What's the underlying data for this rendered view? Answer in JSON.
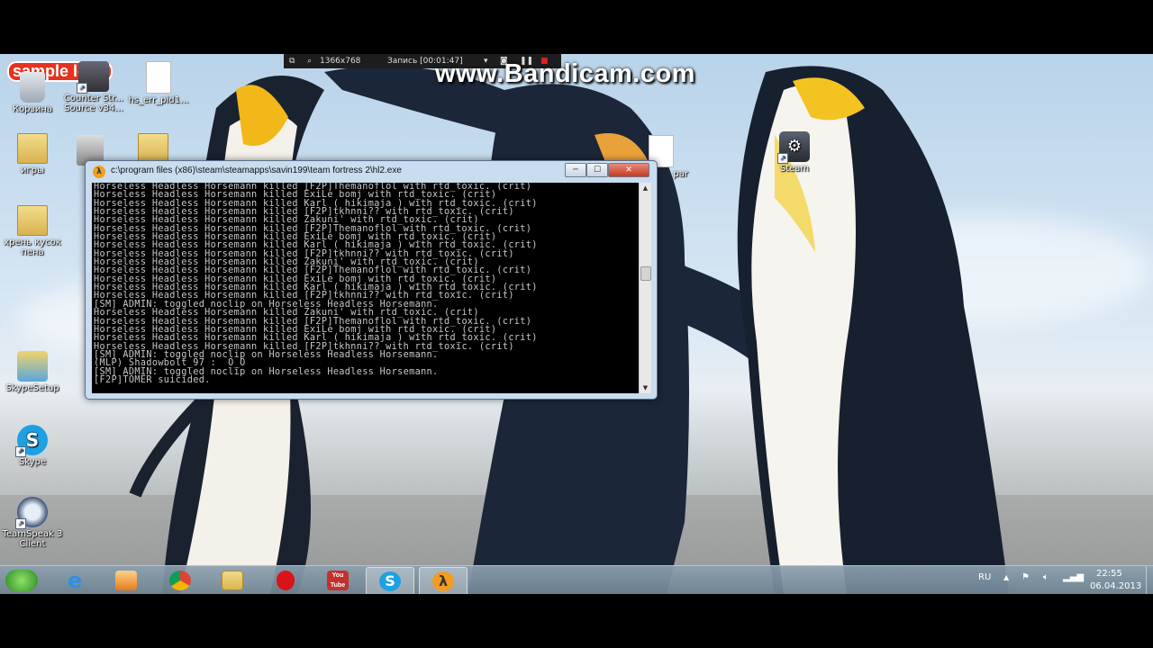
{
  "recording_bar": {
    "resolution": "1366x768",
    "status": "Запись [00:01:47]"
  },
  "watermark": "www.Bandicam.com",
  "sample_logo": "sample logo",
  "desktop_icons": [
    {
      "id": "recycle",
      "label": "Корзина"
    },
    {
      "id": "cs",
      "label": "Counter Str... Source v34..."
    },
    {
      "id": "hs_err",
      "label": "hs_err_pid1..."
    },
    {
      "id": "igry",
      "label": "игры"
    },
    {
      "id": "hren",
      "label": "хрень кусок пена"
    },
    {
      "id": "skypesetup",
      "label": "SkypeSetup"
    },
    {
      "id": "skype",
      "label": "Skype"
    },
    {
      "id": "ts3",
      "label": "TeamSpeak 3 Client"
    },
    {
      "id": "steam",
      "label": "Steam"
    },
    {
      "id": "par",
      "label": "par"
    }
  ],
  "console_window": {
    "title": "c:\\program files (x86)\\steam\\steamapps\\savin199\\team fortress 2\\hl2.exe",
    "lines": [
      "Horseless Headless Horsemann killed [F2P]Themanoflol with rtd_toxic. (crit)",
      "Horseless Headless Horsemann killed ExiLe bomj with rtd_toxic. (crit)",
      "Horseless Headless Horsemann killed Karl ( hikimaja ) with rtd_toxic. (crit)",
      "Horseless Headless Horsemann killed [F2P]tkhnni?? with rtd_toxic. (crit)",
      "Horseless Headless Horsemann killed Zakuni' with rtd_toxic. (crit)",
      "Horseless Headless Horsemann killed [F2P]Themanoflol with rtd_toxic. (crit)",
      "Horseless Headless Horsemann killed ExiLe bomj with rtd_toxic. (crit)",
      "Horseless Headless Horsemann killed Karl ( hikimaja ) with rtd_toxic. (crit)",
      "Horseless Headless Horsemann killed [F2P]tkhnni?? with rtd_toxic. (crit)",
      "Horseless Headless Horsemann killed Zakuni' with rtd_toxic. (crit)",
      "Horseless Headless Horsemann killed [F2P]Themanoflol with rtd_toxic. (crit)",
      "Horseless Headless Horsemann killed ExiLe bomj with rtd_toxic. (crit)",
      "Horseless Headless Horsemann killed Karl ( hikimaja ) with rtd_toxic. (crit)",
      "Horseless Headless Horsemann killed [F2P]tkhnni?? with rtd_toxic. (crit)",
      "[SM] ADMIN: toggled noclip on Horseless Headless Horsemann.",
      "Horseless Headless Horsemann killed Zakuni' with rtd_toxic. (crit)",
      "Horseless Headless Horsemann killed [F2P]Themanoflol with rtd_toxic. (crit)",
      "Horseless Headless Horsemann killed ExiLe bomj with rtd_toxic. (crit)",
      "Horseless Headless Horsemann killed Karl ( hikimaja ) with rtd_toxic. (crit)",
      "Horseless Headless Horsemann killed [F2P]tkhnni?? with rtd_toxic. (crit)",
      "[SM] ADMIN: toggled noclip on Horseless Headless Horsemann.",
      "(MLP) Shadowbolt_97 :  O_O",
      "[SM] ADMIN: toggled noclip on Horseless Headless Horsemann.",
      "[F2P]TOMER suicided."
    ],
    "scroll_position": 0.42
  },
  "taskbar": {
    "language": "RU",
    "time": "22:55",
    "date": "06.04.2013",
    "apps": [
      {
        "id": "start",
        "icon": "start-orb-icon"
      },
      {
        "id": "ie",
        "icon": "internet-explorer-icon"
      },
      {
        "id": "media",
        "icon": "media-player-icon"
      },
      {
        "id": "chrome",
        "icon": "chrome-icon"
      },
      {
        "id": "explorer",
        "icon": "file-explorer-icon"
      },
      {
        "id": "opera",
        "icon": "opera-icon"
      },
      {
        "id": "youtube",
        "icon": "youtube-icon",
        "label": "You Tube"
      },
      {
        "id": "skype",
        "icon": "skype-icon"
      },
      {
        "id": "hl2",
        "icon": "half-life-icon"
      }
    ]
  }
}
